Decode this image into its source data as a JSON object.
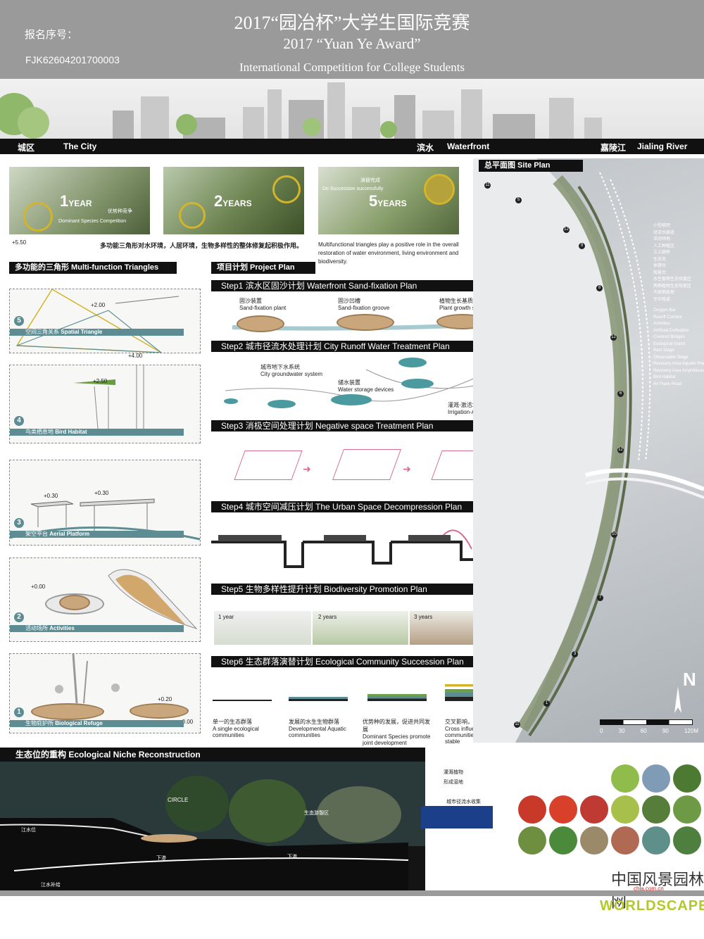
{
  "header": {
    "title_cn": "2017“园冶杯”大学生国际竞赛",
    "title_en": "2017 “Yuan Ye Award”",
    "subtitle": "International Competition for College Students",
    "reg_label": "报名序号：",
    "reg_number": "FJK62604201700003"
  },
  "strip": {
    "city_cn": "城区",
    "city_en": "The City",
    "water_cn": "滨水",
    "water_en": "Waterfront",
    "river_cn": "嘉陵江",
    "river_en": "Jialing River"
  },
  "timeline": [
    {
      "num": "1",
      "unit": "YEAR",
      "cap_cn": "优势种竞争",
      "cap_en": "Dominant Species Competition"
    },
    {
      "num": "2",
      "unit": "YEARS",
      "cap_cn": "",
      "cap_en": ""
    },
    {
      "num": "5",
      "unit": "YEARS",
      "cap_cn": "演替完成",
      "cap_en": "Do Succession successfully"
    }
  ],
  "intro": {
    "cn": "多功能三角形对水环境，人居环境，生物多样性的整体修复起积极作用。",
    "en": "Multifunctional triangles play a positive role in the overall restoration of water environment, living environment and biodiversity."
  },
  "triangles": {
    "heading": "多功能的三角形  Multi-function Triangles",
    "items": [
      {
        "num": "5",
        "cn": "空间三角关系",
        "en": "Spatial Triangle",
        "elev": [
          "+5.50",
          "+2.00"
        ]
      },
      {
        "num": "4",
        "cn": "鸟类栖息地",
        "en": "Bird Habitat",
        "elev": [
          "+4.00",
          "+2.50"
        ]
      },
      {
        "num": "3",
        "cn": "架空平台",
        "en": "Aerial Platform",
        "elev": [
          "+0.30",
          "+0.30"
        ]
      },
      {
        "num": "2",
        "cn": "活动场所",
        "en": "Activities",
        "elev": [
          "+0.00"
        ]
      },
      {
        "num": "1",
        "cn": "生物庇护所",
        "en": "Biological Refuge",
        "elev": [
          "+0.20",
          "+0.00"
        ]
      }
    ]
  },
  "project": {
    "heading": "项目计划  Project Plan",
    "steps": [
      {
        "label": "Step1   滨水区固沙计划   Waterfront Sand-fixation Plan"
      },
      {
        "label": "Step2   城市径流水处理计划   City Runoff Water Treatment Plan"
      },
      {
        "label": "Step3   消极空间处理计划   Negative space Treatment Plan"
      },
      {
        "label": "Step4   城市空间减压计划   The Urban Space Decompression Plan"
      },
      {
        "label": "Step5   生物多样性提升计划   Biodiversity Promotion Plan"
      },
      {
        "label": "Step6   生态群落演替计划   Ecological Community Succession Plan"
      }
    ],
    "step1_labels": [
      {
        "cn": "固沙装置",
        "en": "Sand-fixation plant"
      },
      {
        "cn": "固沙凹槽",
        "en": "Sand-fixation groove"
      },
      {
        "cn": "植物生长基质",
        "en": "Plant growth substrate"
      }
    ],
    "step2_labels": [
      {
        "cn": "城市地下水系统",
        "en": "City groundwater system"
      },
      {
        "cn": "储水装置",
        "en": "Water storage devices"
      },
      {
        "cn": "灌溉-激活场地",
        "en": "Irrigation-Activate the Site"
      }
    ],
    "step5_labels": [
      "1 year",
      "2 years",
      "3 years"
    ],
    "step6_labels": [
      {
        "cn": "单一的生态群落",
        "en": "A single ecological communities"
      },
      {
        "cn": "发展的水生生物群落",
        "en": "Developmental Aquatic communities"
      },
      {
        "cn": "优势种的发展，促进共同发展",
        "en": "Dominant Species promote joint development"
      },
      {
        "cn": "交叉影响，趋于稳定",
        "en": "Cross influence, communities tend to be stable"
      }
    ]
  },
  "site_plan": {
    "heading": "总平面图   Site Plan",
    "legend_cn": [
      "小型眺吧",
      "径流水廊道",
      "活动场地",
      "人工种植区",
      "江上廊桥",
      "生态岛",
      "休憩台",
      "观景台",
      "水生植物生态恢复区",
      "两栖植物生态恢复区",
      "鸟类栖息地",
      "空中栈道"
    ],
    "legend_en": [
      "Oxygen Bar",
      "Runoff Corridor",
      "Activities",
      "Artificial Cultivation",
      "Covered Bridges",
      "Ecological Island",
      "Rest Stage",
      "Observation Stage",
      "Recovery Area Aquatic Plants",
      "Recovery Area Amphibious Plants",
      "Bird Habitat",
      "Air Plank Road"
    ],
    "north": "N",
    "scale": [
      "0",
      "30",
      "60",
      "90",
      "120M"
    ]
  },
  "ecology": {
    "heading": "生态位的重构   Ecological Niche Reconstruction",
    "labels": [
      "CIRCLE",
      "江水位",
      "生态游憩区",
      "下渗",
      "下渗",
      "江水补给"
    ],
    "callouts": [
      "灌溉植物",
      "形成湿地",
      "城市径流水收集"
    ]
  },
  "watermark": {
    "cn": "中国风景园林网",
    "url": "chla.com.cn",
    "brand": "WORLDSCAPE"
  },
  "colors": {
    "header_gray": "#9a9a9a",
    "teal": "#5d8d93",
    "accent_yellow": "#d4b42a",
    "pink": "#d66b8d"
  }
}
